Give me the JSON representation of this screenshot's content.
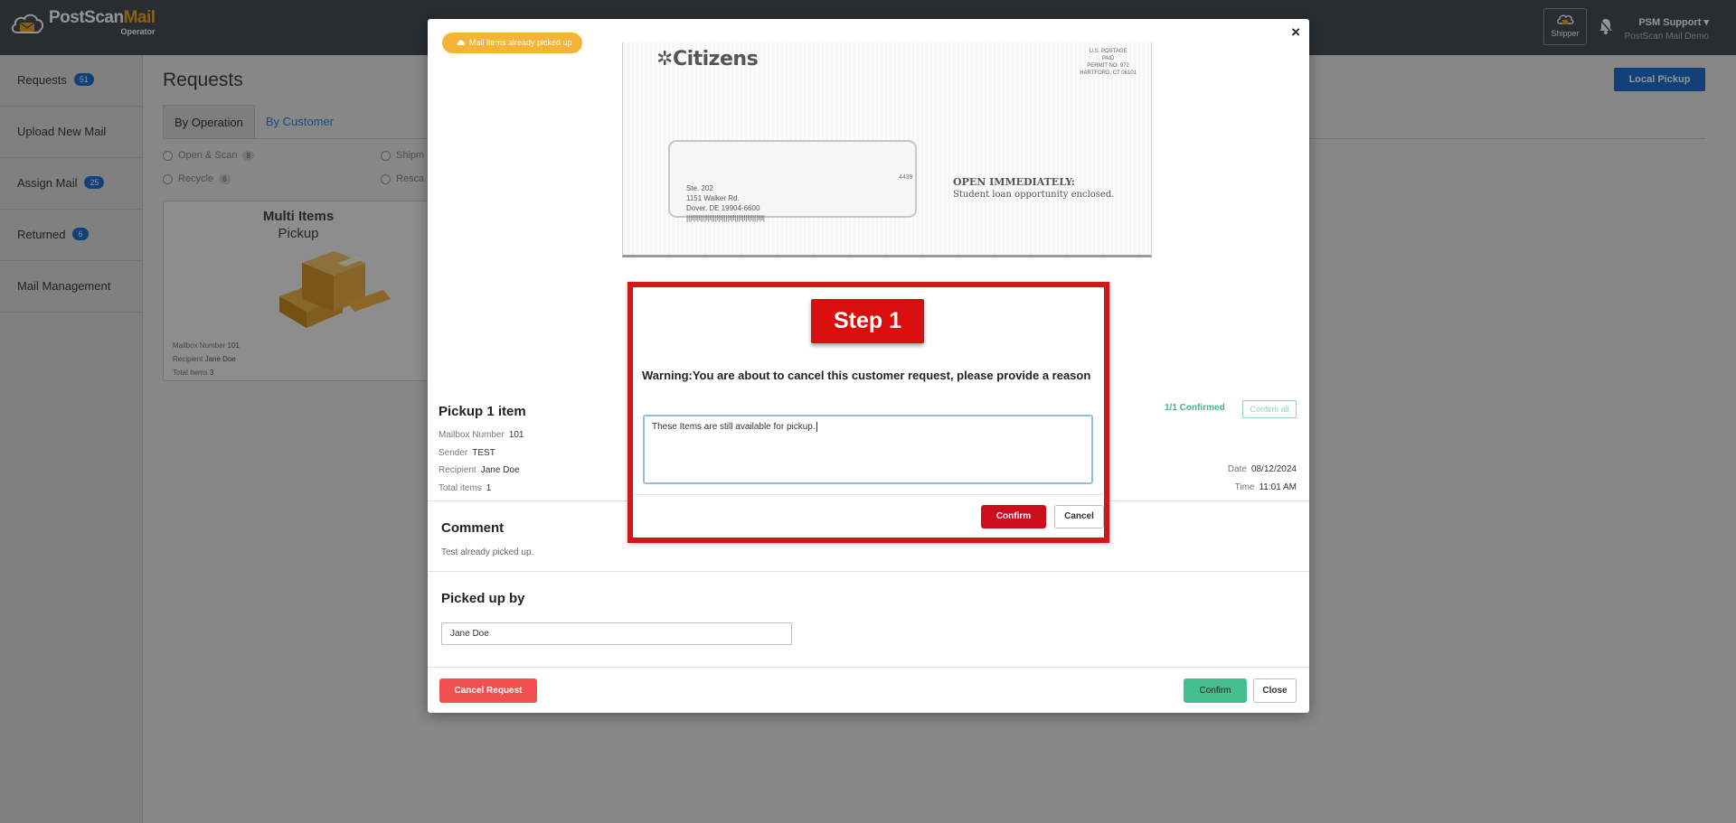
{
  "app": {
    "logo_text_a": "PostScan",
    "logo_text_b": "Mail",
    "logo_sub": "Operator",
    "shipper_label": "Shipper",
    "user_name": "PSM Support",
    "user_org": "PostScan Mail Demo"
  },
  "sidebar": {
    "items": [
      {
        "label": "Requests",
        "badge": "51"
      },
      {
        "label": "Upload New Mail",
        "badge": ""
      },
      {
        "label": "Assign Mail",
        "badge": "25"
      },
      {
        "label": "Returned",
        "badge": "6"
      },
      {
        "label": "Mail Management",
        "badge": ""
      }
    ]
  },
  "main": {
    "title": "Requests",
    "local_pickup": "Local Pickup",
    "tabs": [
      {
        "label": "By Operation",
        "active": true
      },
      {
        "label": "By Customer",
        "active": false
      }
    ],
    "filters": [
      {
        "label": "Open & Scan",
        "count": "8"
      },
      {
        "label": "Recycle",
        "count": "6"
      },
      {
        "label": "Shipm"
      },
      {
        "label": "Resca"
      }
    ],
    "card": {
      "title": "Multi Items",
      "subtitle": "Pickup",
      "mailbox_label": "Mailbox Number",
      "mailbox_value": "101",
      "recipient_label": "Recipient",
      "recipient_value": "Jane Doe",
      "total_label": "Total Items",
      "total_value": "3"
    }
  },
  "modal": {
    "close_icon": "×",
    "status_badge": "Mail items already picked up",
    "envelope": {
      "brand": "Citizens",
      "postage": [
        "U.S. POSTAGE",
        "PAID",
        "PERMIT NO. 972",
        "HARTFORD, CT 06101"
      ],
      "code": "4439",
      "address": [
        "Ste. 202",
        "1151 Walker Rd.",
        "Dover, DE 19904-6600"
      ],
      "barcode": "|||l|l|l|||l|l|||l|l||||l|l|||l|l|l|l|||l|l|",
      "open_line1": "OPEN IMMEDIATELY:",
      "open_line2": "Student loan opportunity enclosed."
    },
    "pickup_title": "Pickup 1 item",
    "mailbox_label": "Mailbox Number",
    "mailbox_value": "101",
    "sender_label": "Sender",
    "sender_value": "TEST",
    "recipient_label": "Recipient",
    "recipient_value": "Jane Doe",
    "total_label": "Total items",
    "total_value": "1",
    "confirmed_status": "1/1 Confirmed",
    "confirm_all": "Confirm all",
    "date_label": "Date",
    "date_value": "08/12/2024",
    "time_label": "Time",
    "time_value": "11:01 AM",
    "comment_title": "Comment",
    "comment_text": "Test already picked up.",
    "picked_up_title": "Picked up by",
    "picked_up_value": "Jane Doe",
    "cancel_request": "Cancel Request",
    "confirm": "Confirm",
    "close": "Close"
  },
  "warning_dialog": {
    "step_label": "Step 1",
    "message": "Warning:You are about to cancel this customer request, please provide a reason",
    "reason_value": "These Items are still available for pickup.",
    "confirm": "Confirm",
    "cancel": "Cancel"
  },
  "colors": {
    "topbar": "#474e55",
    "accent_blue": "#1f6fd1",
    "warning_red": "#d01818",
    "badge_orange": "#f5b435",
    "confirm_green": "#45bf8f",
    "cancel_red": "#f25050"
  }
}
